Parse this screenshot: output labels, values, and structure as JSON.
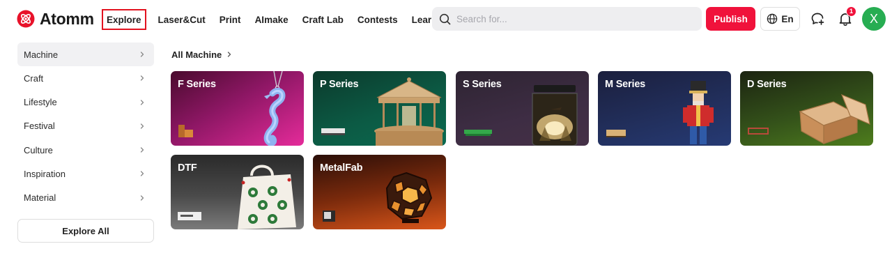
{
  "brand": {
    "name": "Atomm",
    "accent": "#f0123b"
  },
  "nav": [
    {
      "label": "Explore",
      "active": true
    },
    {
      "label": "Laser&Cut"
    },
    {
      "label": "Print"
    },
    {
      "label": "AImake"
    },
    {
      "label": "Craft Lab"
    },
    {
      "label": "Contests"
    },
    {
      "label": "Learn",
      "has_dropdown": true
    }
  ],
  "search": {
    "placeholder": "Search for..."
  },
  "header": {
    "publish_label": "Publish",
    "language_label": "En",
    "notification_count": "1",
    "avatar_initial": "X"
  },
  "sidebar": {
    "items": [
      {
        "label": "Machine",
        "active": true
      },
      {
        "label": "Craft"
      },
      {
        "label": "Lifestyle"
      },
      {
        "label": "Festival"
      },
      {
        "label": "Culture"
      },
      {
        "label": "Inspiration"
      },
      {
        "label": "Material"
      }
    ],
    "explore_all_label": "Explore All"
  },
  "main": {
    "breadcrumb": "All Machine",
    "cards": [
      {
        "title": "F Series"
      },
      {
        "title": "P Series"
      },
      {
        "title": "S Series"
      },
      {
        "title": "M Series"
      },
      {
        "title": "D Series"
      },
      {
        "title": "DTF"
      },
      {
        "title": "MetalFab"
      }
    ]
  }
}
